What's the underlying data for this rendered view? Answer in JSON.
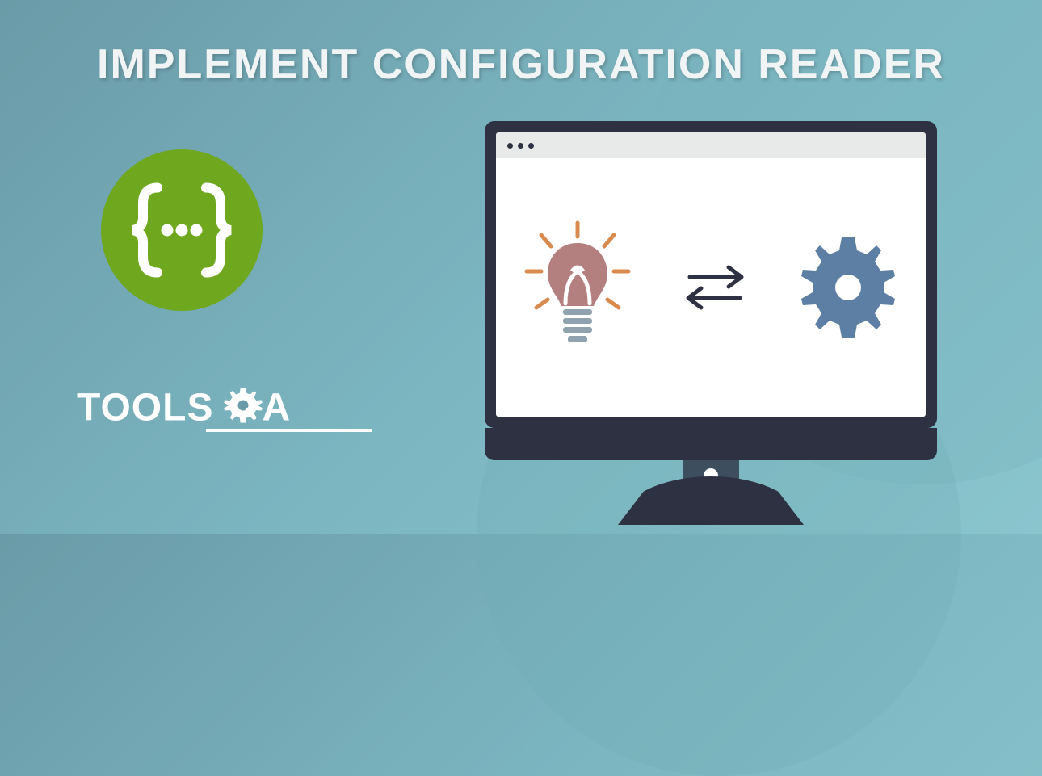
{
  "heading": "IMPLEMENT CONFIGURATION READER",
  "logo": {
    "text_a": "TOOLS",
    "text_b": "A"
  },
  "json_badge": {
    "symbol": "{...}"
  },
  "monitor": {
    "icons": [
      "lightbulb",
      "bidirectional-arrows",
      "gear"
    ]
  },
  "colors": {
    "badge": "#6fa81f",
    "monitor": "#2d3142",
    "bulb": "#b37f7f",
    "gear": "#5d7fa3",
    "rays": "#d98b4f"
  }
}
